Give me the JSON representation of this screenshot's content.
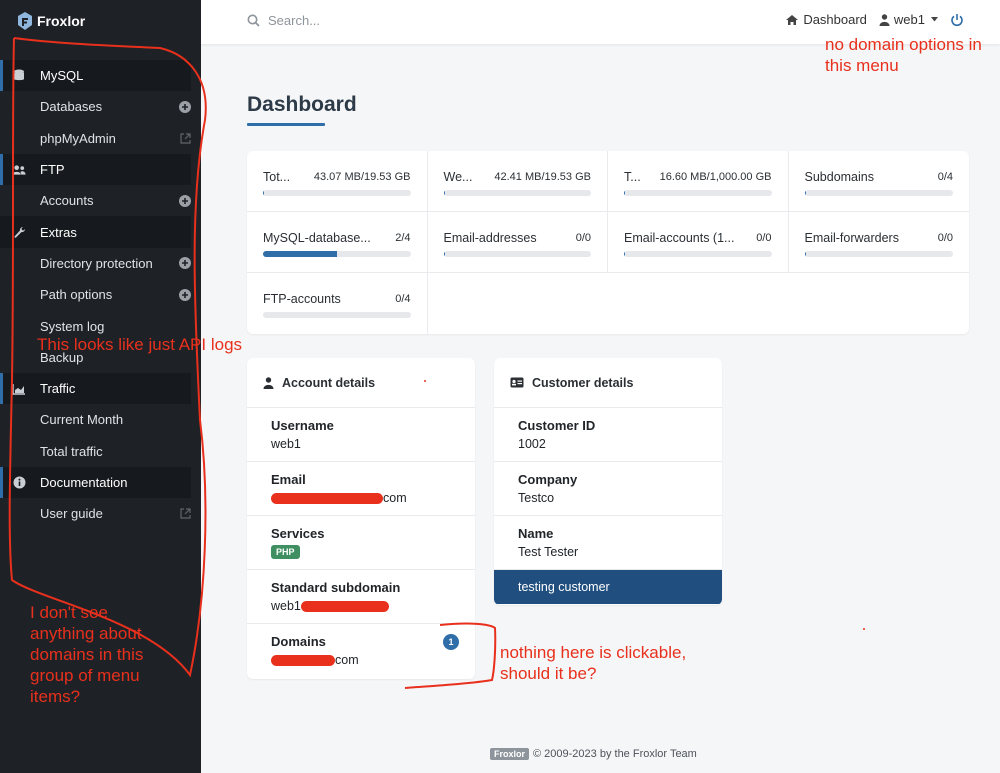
{
  "app": {
    "name": "Froxlor"
  },
  "sidebar": {
    "groups": [
      {
        "label": "MySQL",
        "icon": "database-icon",
        "items": [
          {
            "label": "Databases",
            "icon": "plus-circle-icon"
          },
          {
            "label": "phpMyAdmin",
            "icon": "external-link-icon"
          }
        ]
      },
      {
        "label": "FTP",
        "icon": "users-icon",
        "items": [
          {
            "label": "Accounts",
            "icon": "plus-circle-icon"
          }
        ]
      },
      {
        "label": "Extras",
        "icon": "wrench-icon",
        "items": [
          {
            "label": "Directory protection",
            "icon": "plus-circle-icon"
          },
          {
            "label": "Path options",
            "icon": "plus-circle-icon"
          },
          {
            "label": "System log",
            "icon": ""
          },
          {
            "label": "Backup",
            "icon": ""
          }
        ]
      },
      {
        "label": "Traffic",
        "icon": "chart-area-icon",
        "items": [
          {
            "label": "Current Month",
            "icon": ""
          },
          {
            "label": "Total traffic",
            "icon": ""
          }
        ]
      },
      {
        "label": "Documentation",
        "icon": "info-icon",
        "items": [
          {
            "label": "User guide",
            "icon": "external-link-icon"
          }
        ]
      }
    ]
  },
  "topbar": {
    "search_placeholder": "Search...",
    "dashboard_label": "Dashboard",
    "user_label": "web1"
  },
  "main": {
    "title": "Dashboard",
    "stats": [
      {
        "label": "Tot...",
        "value": "43.07 MB/19.53 GB",
        "fill": 0.01
      },
      {
        "label": "We...",
        "value": "42.41 MB/19.53 GB",
        "fill": 0.01
      },
      {
        "label": "T...",
        "value": "16.60 MB/1,000.00 GB",
        "fill": 0.01
      },
      {
        "label": "Subdomains",
        "value": "0/4",
        "fill": 0.01
      },
      {
        "label": "MySQL-database...",
        "value": "2/4",
        "fill": 0.5
      },
      {
        "label": "Email-addresses",
        "value": "0/0",
        "fill": 0.01
      },
      {
        "label": "Email-accounts (1...",
        "value": "0/0",
        "fill": 0.01
      },
      {
        "label": "Email-forwarders",
        "value": "0/0",
        "fill": 0.01
      },
      {
        "label": "FTP-accounts",
        "value": "0/4",
        "fill": 0.0
      }
    ],
    "account": {
      "title": "Account details",
      "username_label": "Username",
      "username": "web1",
      "email_label": "Email",
      "email_suffix": "com",
      "services_label": "Services",
      "services_badge": "PHP",
      "std_sub_label": "Standard subdomain",
      "std_sub_prefix": "web1",
      "domains_label": "Domains",
      "domains_suffix": "com",
      "domains_count": "1"
    },
    "customer": {
      "title": "Customer details",
      "id_label": "Customer ID",
      "id": "1002",
      "company_label": "Company",
      "company": "Testco",
      "name_label": "Name",
      "name": "Test Tester",
      "note": "testing customer"
    }
  },
  "footer": {
    "logo": "Froxlor",
    "text": "© 2009-2023 by the Froxlor Team"
  },
  "annotations": {
    "top": "no domain options in this menu",
    "api": "This looks like just API logs",
    "domains": "I don't see anything about domains in this group of menu items?",
    "clickable": "nothing here is clickable, should it be?",
    "color": "#e8301c"
  }
}
